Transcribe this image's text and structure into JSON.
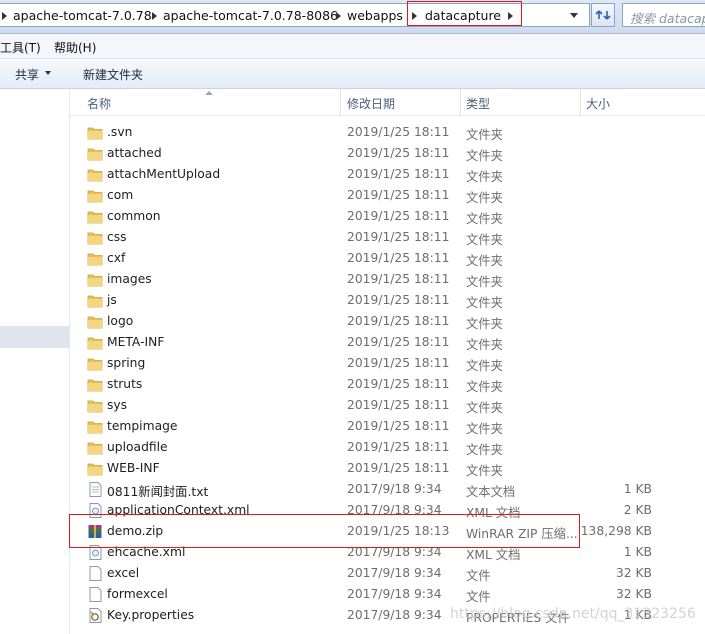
{
  "address_bar": {
    "crumbs": [
      "apache-tomcat-7.0.78",
      "apache-tomcat-7.0.78-8086",
      "webapps",
      "datacapture"
    ],
    "search_placeholder": "搜索 datacapture"
  },
  "menu": {
    "items": [
      "工具(T)",
      "帮助(H)"
    ]
  },
  "command_bar": {
    "share_label": "共享",
    "new_folder_label": "新建文件夹"
  },
  "columns": {
    "name": "名称",
    "modified": "修改日期",
    "type": "类型",
    "size": "大小"
  },
  "files": [
    {
      "name": ".svn",
      "date": "2019/1/25 18:11",
      "type": "文件夹",
      "size": "",
      "icon": "folder-icon"
    },
    {
      "name": "attached",
      "date": "2019/1/25 18:11",
      "type": "文件夹",
      "size": "",
      "icon": "folder-icon"
    },
    {
      "name": "attachMentUpload",
      "date": "2019/1/25 18:11",
      "type": "文件夹",
      "size": "",
      "icon": "folder-icon"
    },
    {
      "name": "com",
      "date": "2019/1/25 18:11",
      "type": "文件夹",
      "size": "",
      "icon": "folder-icon"
    },
    {
      "name": "common",
      "date": "2019/1/25 18:11",
      "type": "文件夹",
      "size": "",
      "icon": "folder-icon"
    },
    {
      "name": "css",
      "date": "2019/1/25 18:11",
      "type": "文件夹",
      "size": "",
      "icon": "folder-icon"
    },
    {
      "name": "cxf",
      "date": "2019/1/25 18:11",
      "type": "文件夹",
      "size": "",
      "icon": "folder-icon"
    },
    {
      "name": "images",
      "date": "2019/1/25 18:11",
      "type": "文件夹",
      "size": "",
      "icon": "folder-icon"
    },
    {
      "name": "js",
      "date": "2019/1/25 18:11",
      "type": "文件夹",
      "size": "",
      "icon": "folder-icon"
    },
    {
      "name": "logo",
      "date": "2019/1/25 18:11",
      "type": "文件夹",
      "size": "",
      "icon": "folder-icon"
    },
    {
      "name": "META-INF",
      "date": "2019/1/25 18:11",
      "type": "文件夹",
      "size": "",
      "icon": "folder-icon"
    },
    {
      "name": "spring",
      "date": "2019/1/25 18:11",
      "type": "文件夹",
      "size": "",
      "icon": "folder-icon"
    },
    {
      "name": "struts",
      "date": "2019/1/25 18:11",
      "type": "文件夹",
      "size": "",
      "icon": "folder-icon"
    },
    {
      "name": "sys",
      "date": "2019/1/25 18:11",
      "type": "文件夹",
      "size": "",
      "icon": "folder-icon"
    },
    {
      "name": "tempimage",
      "date": "2019/1/25 18:11",
      "type": "文件夹",
      "size": "",
      "icon": "folder-icon"
    },
    {
      "name": "uploadfile",
      "date": "2019/1/25 18:11",
      "type": "文件夹",
      "size": "",
      "icon": "folder-icon"
    },
    {
      "name": "WEB-INF",
      "date": "2019/1/25 18:11",
      "type": "文件夹",
      "size": "",
      "icon": "folder-icon"
    },
    {
      "name": "0811新闻封面.txt",
      "date": "2017/9/18 9:34",
      "type": "文本文档",
      "size": "1 KB",
      "icon": "text-file-icon"
    },
    {
      "name": "applicationContext.xml",
      "date": "2017/9/18 9:34",
      "type": "XML 文档",
      "size": "2 KB",
      "icon": "xml-file-icon"
    },
    {
      "name": "demo.zip",
      "date": "2019/1/25 18:13",
      "type": "WinRAR ZIP 压缩...",
      "size": "138,298 KB",
      "icon": "winrar-archive-icon"
    },
    {
      "name": "ehcache.xml",
      "date": "2017/9/18 9:34",
      "type": "XML 文档",
      "size": "1 KB",
      "icon": "xml-file-icon"
    },
    {
      "name": "excel",
      "date": "2017/9/18 9:34",
      "type": "文件",
      "size": "32 KB",
      "icon": "blank-file-icon"
    },
    {
      "name": "formexcel",
      "date": "2017/9/18 9:34",
      "type": "文件",
      "size": "32 KB",
      "icon": "blank-file-icon"
    },
    {
      "name": "Key.properties",
      "date": "2017/9/18 9:34",
      "type": "PROPERTIES 文件",
      "size": "1 KB",
      "icon": "properties-file-icon"
    }
  ],
  "watermark": "https://blog.csdn.net/qq_31323256",
  "colors": {
    "highlight_red": "#e0191b",
    "folder_yellow": "#e8c05a"
  }
}
